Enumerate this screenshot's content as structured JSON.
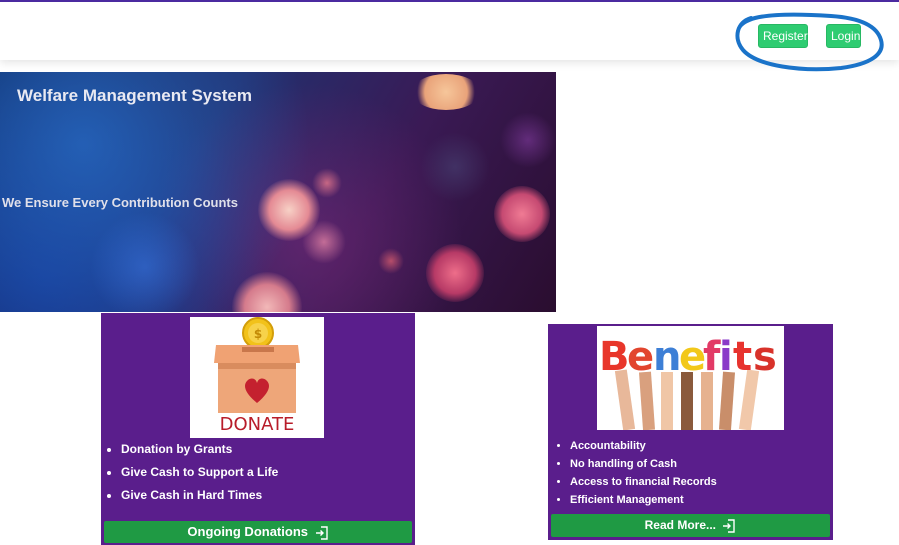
{
  "header": {
    "register_label": "Register",
    "login_label": "Login",
    "accent_color": "#2ecc71"
  },
  "hero": {
    "title": "Welfare Management System",
    "tagline": "We Ensure Every Contribution Counts"
  },
  "donations_card": {
    "image_caption": "DONATE",
    "items": [
      "Donation by Grants",
      "Give Cash to Support a Life",
      "Give Cash in Hard Times"
    ],
    "button_label": "Ongoing Donations",
    "button_icon": "enter-icon"
  },
  "benefits_card": {
    "image_word": "Benefits",
    "items": [
      "Accountability",
      "No handling of Cash",
      "Access to financial Records",
      "Efficient Management"
    ],
    "button_label": "Read More...",
    "button_icon": "enter-icon"
  },
  "colors": {
    "card_background": "#5a1e8c",
    "button_green": "#1f9a44",
    "annotation_blue": "#1a73c9"
  }
}
